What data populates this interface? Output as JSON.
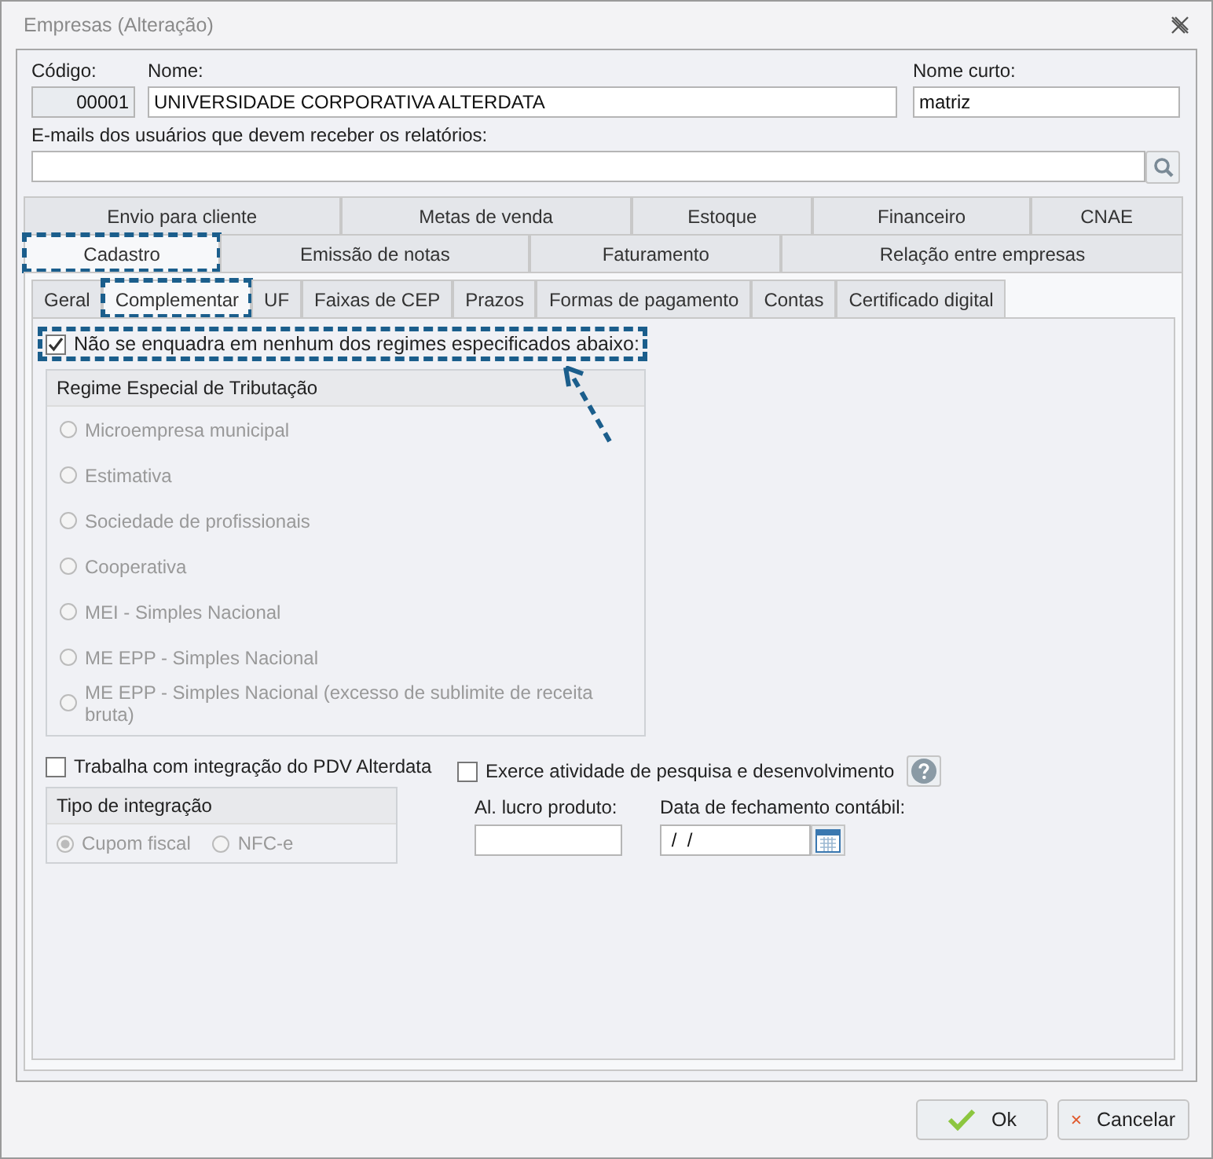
{
  "window": {
    "title": "Empresas (Alteração)"
  },
  "header": {
    "codigo": {
      "label": "Código:",
      "value": "00001"
    },
    "nome": {
      "label": "Nome:",
      "value": "UNIVERSIDADE CORPORATIVA ALTERDATA"
    },
    "nome_curto": {
      "label": "Nome curto:",
      "value": "matriz"
    },
    "emails": {
      "label": "E-mails dos usuários que devem receber os relatórios:"
    }
  },
  "tab_rows": [
    [
      {
        "label": "Envio para cliente",
        "selected": false,
        "highlighted": false
      },
      {
        "label": "Metas de venda",
        "selected": false,
        "highlighted": false
      },
      {
        "label": "Estoque",
        "selected": false,
        "highlighted": false
      },
      {
        "label": "Financeiro",
        "selected": false,
        "highlighted": false
      },
      {
        "label": "CNAE",
        "selected": false,
        "highlighted": false
      }
    ],
    [
      {
        "label": "Cadastro",
        "selected": true,
        "highlighted": true
      },
      {
        "label": "Emissão de notas",
        "selected": false,
        "highlighted": false
      },
      {
        "label": "Faturamento",
        "selected": false,
        "highlighted": false
      },
      {
        "label": "Relação entre empresas",
        "selected": false,
        "highlighted": false
      }
    ]
  ],
  "sub_tabs": [
    {
      "label": "Geral",
      "selected": false,
      "highlighted": false
    },
    {
      "label": "Complementar",
      "selected": true,
      "highlighted": true
    },
    {
      "label": "UF",
      "selected": false,
      "highlighted": false
    },
    {
      "label": "Faixas de CEP",
      "selected": false,
      "highlighted": false
    },
    {
      "label": "Prazos",
      "selected": false,
      "highlighted": false
    },
    {
      "label": "Formas de pagamento",
      "selected": false,
      "highlighted": false
    },
    {
      "label": "Contas",
      "selected": false,
      "highlighted": false
    },
    {
      "label": "Certificado digital",
      "selected": false,
      "highlighted": false
    }
  ],
  "nao_enquadra": {
    "label": "Não se enquadra em nenhum dos regimes especificados abaixo:",
    "checked": true,
    "highlighted": true
  },
  "regime": {
    "title": "Regime Especial de Tributação",
    "options": [
      {
        "label": "Microempresa municipal",
        "selected": false,
        "disabled": true
      },
      {
        "label": "Estimativa",
        "selected": false,
        "disabled": true
      },
      {
        "label": "Sociedade de profissionais",
        "selected": false,
        "disabled": true
      },
      {
        "label": "Cooperativa",
        "selected": false,
        "disabled": true
      },
      {
        "label": "MEI - Simples Nacional",
        "selected": false,
        "disabled": true
      },
      {
        "label": "ME EPP - Simples Nacional",
        "selected": false,
        "disabled": true
      },
      {
        "label": "ME EPP - Simples Nacional (excesso de sublimite de receita bruta)",
        "selected": false,
        "disabled": true
      }
    ]
  },
  "integracao_pdv": {
    "label": "Trabalha com integração do PDV Alterdata",
    "checked": false
  },
  "tipo_integracao": {
    "title": "Tipo de integração",
    "options": [
      {
        "label": "Cupom fiscal",
        "selected": true,
        "disabled": true
      },
      {
        "label": "NFC-e",
        "selected": false,
        "disabled": true
      }
    ]
  },
  "pesquisa": {
    "label": "Exerce atividade de pesquisa e desenvolvimento",
    "checked": false
  },
  "al_lucro": {
    "label": "Al. lucro produto:"
  },
  "data_fechamento": {
    "label": "Data de fechamento contábil:",
    "value": " /  /"
  },
  "buttons": [
    {
      "kind": "ok",
      "label": "Ok"
    },
    {
      "kind": "cancel",
      "label": "Cancelar"
    }
  ]
}
